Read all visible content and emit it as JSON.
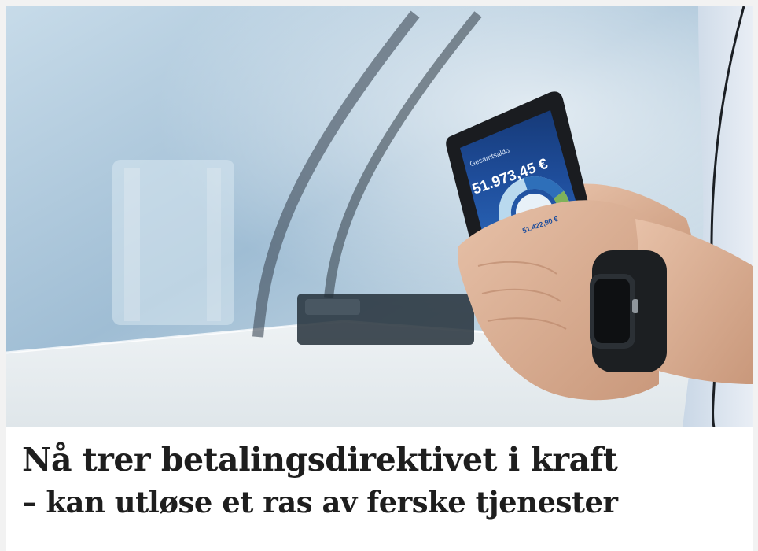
{
  "article": {
    "headline_line1": "Nå trer betalingsdirektivet i kraft",
    "headline_line2": "– kan utløse et ras av ferske tjenester"
  },
  "phone_screen": {
    "header": "Gesamtsaldo",
    "balance": "51.973,45 €",
    "sub_balance": "51.422,90 €"
  },
  "colors": {
    "headline_text": "#1e1e1e",
    "card_background": "#ffffff",
    "page_background": "#f2f2f2",
    "phone_screen_blue": "#1f4e9c"
  }
}
